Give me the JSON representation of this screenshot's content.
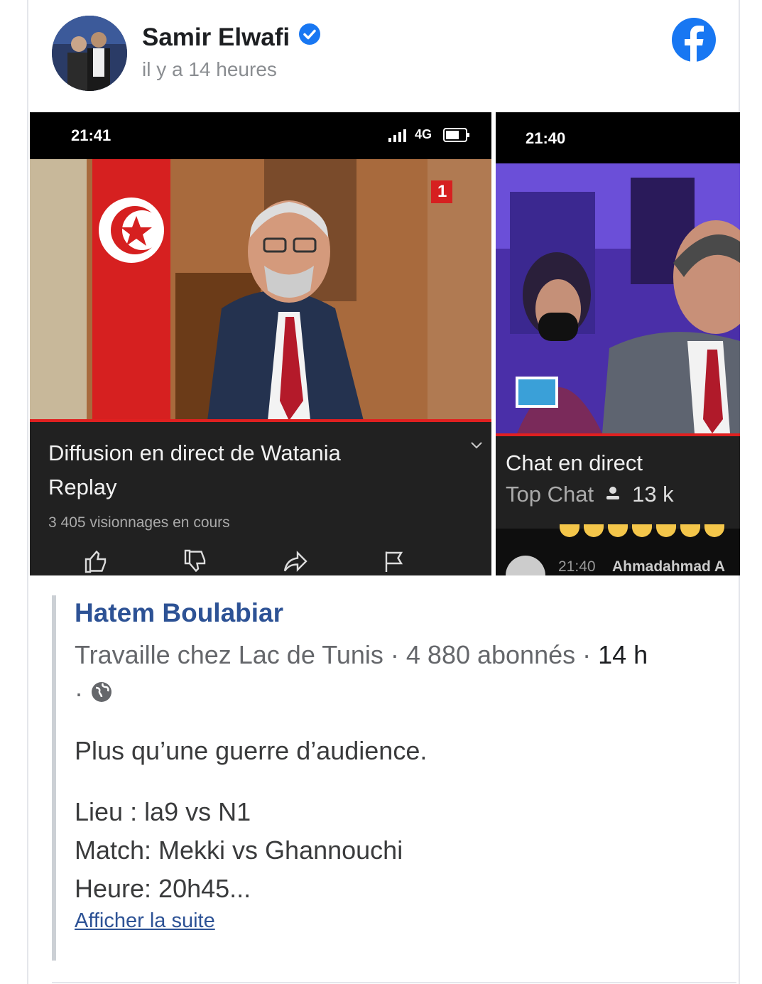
{
  "post": {
    "author": "Samir Elwafi",
    "timestamp": "il y a 14 heures",
    "verified_icon": "verified-badge-icon",
    "platform_icon": "facebook-icon",
    "brand_color": "#1877f2"
  },
  "media": {
    "left": {
      "clock": "21:41",
      "network": "4G",
      "channel_badge": "1",
      "title_line1": "Diffusion en direct de Watania",
      "title_line2": "Replay",
      "viewers": "3 405 visionnages en cours"
    },
    "right": {
      "clock": "21:40",
      "title": "Chat en direct",
      "subtitle": "Top Chat",
      "count": "13 k",
      "chat_time": "21:40",
      "chat_user": "Ahmadahmad A"
    }
  },
  "quoted": {
    "name": "Hatem Boulabiar",
    "meta_work": "Travaille chez Lac de Tunis",
    "meta_followers": "4 880 abonnés",
    "meta_time": "14 h",
    "line1": "Plus qu’une guerre d’audience.",
    "line2": "Lieu : la9 vs N1",
    "line3": "Match: Mekki vs Ghannouchi",
    "line4": "Heure: 20h45...",
    "see_more": "Afficher la suite",
    "link_color": "#2d5295"
  }
}
